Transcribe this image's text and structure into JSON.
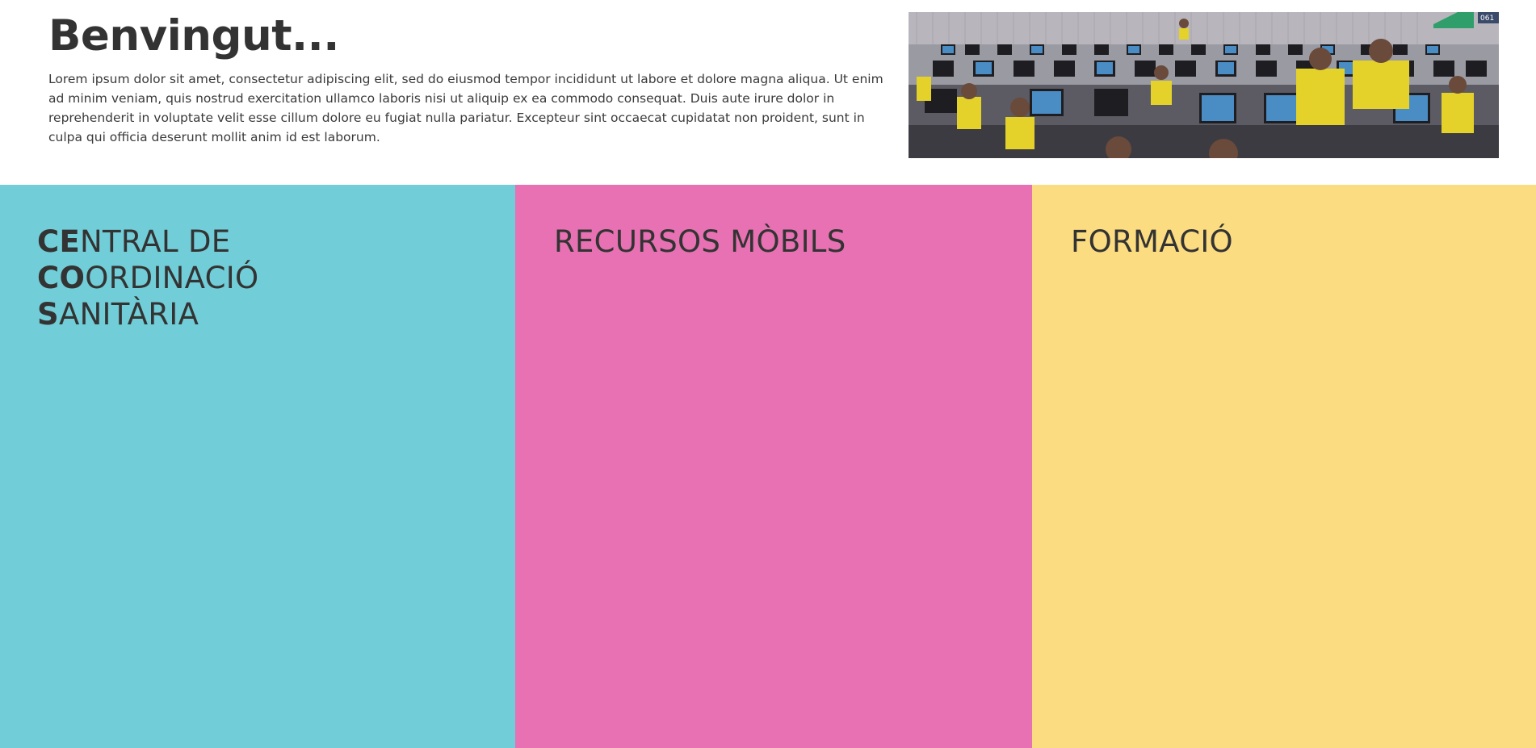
{
  "header": {
    "title": "Benvingut...",
    "intro": "Lorem ipsum dolor sit amet, consectetur adipiscing elit, sed do eiusmod tempor incididunt ut labore et dolore magna aliqua. Ut enim ad minim veniam, quis nostrud exercitation ullamco laboris nisi ut aliquip ex ea commodo consequat. Duis aute irure dolor in reprehenderit in voluptate velit esse cillum dolore eu fugiat nulla pariatur. Excepteur sint occaecat cupidatat non proident, sunt in culpa qui officia deserunt mollit anim id est laborum.",
    "image_overlay_text": "061"
  },
  "panels": [
    {
      "color": "#71cdd7",
      "title_lines": [
        {
          "bold": "CE",
          "rest": "NTRAL DE"
        },
        {
          "bold": "CO",
          "rest": "ORDINACIÓ"
        },
        {
          "bold": "S",
          "rest": "ANITÀRIA"
        }
      ]
    },
    {
      "color": "#e771b2",
      "title": "RECURSOS MÒBILS"
    },
    {
      "color": "#fcdc80",
      "title": "FORMACIÓ"
    }
  ]
}
